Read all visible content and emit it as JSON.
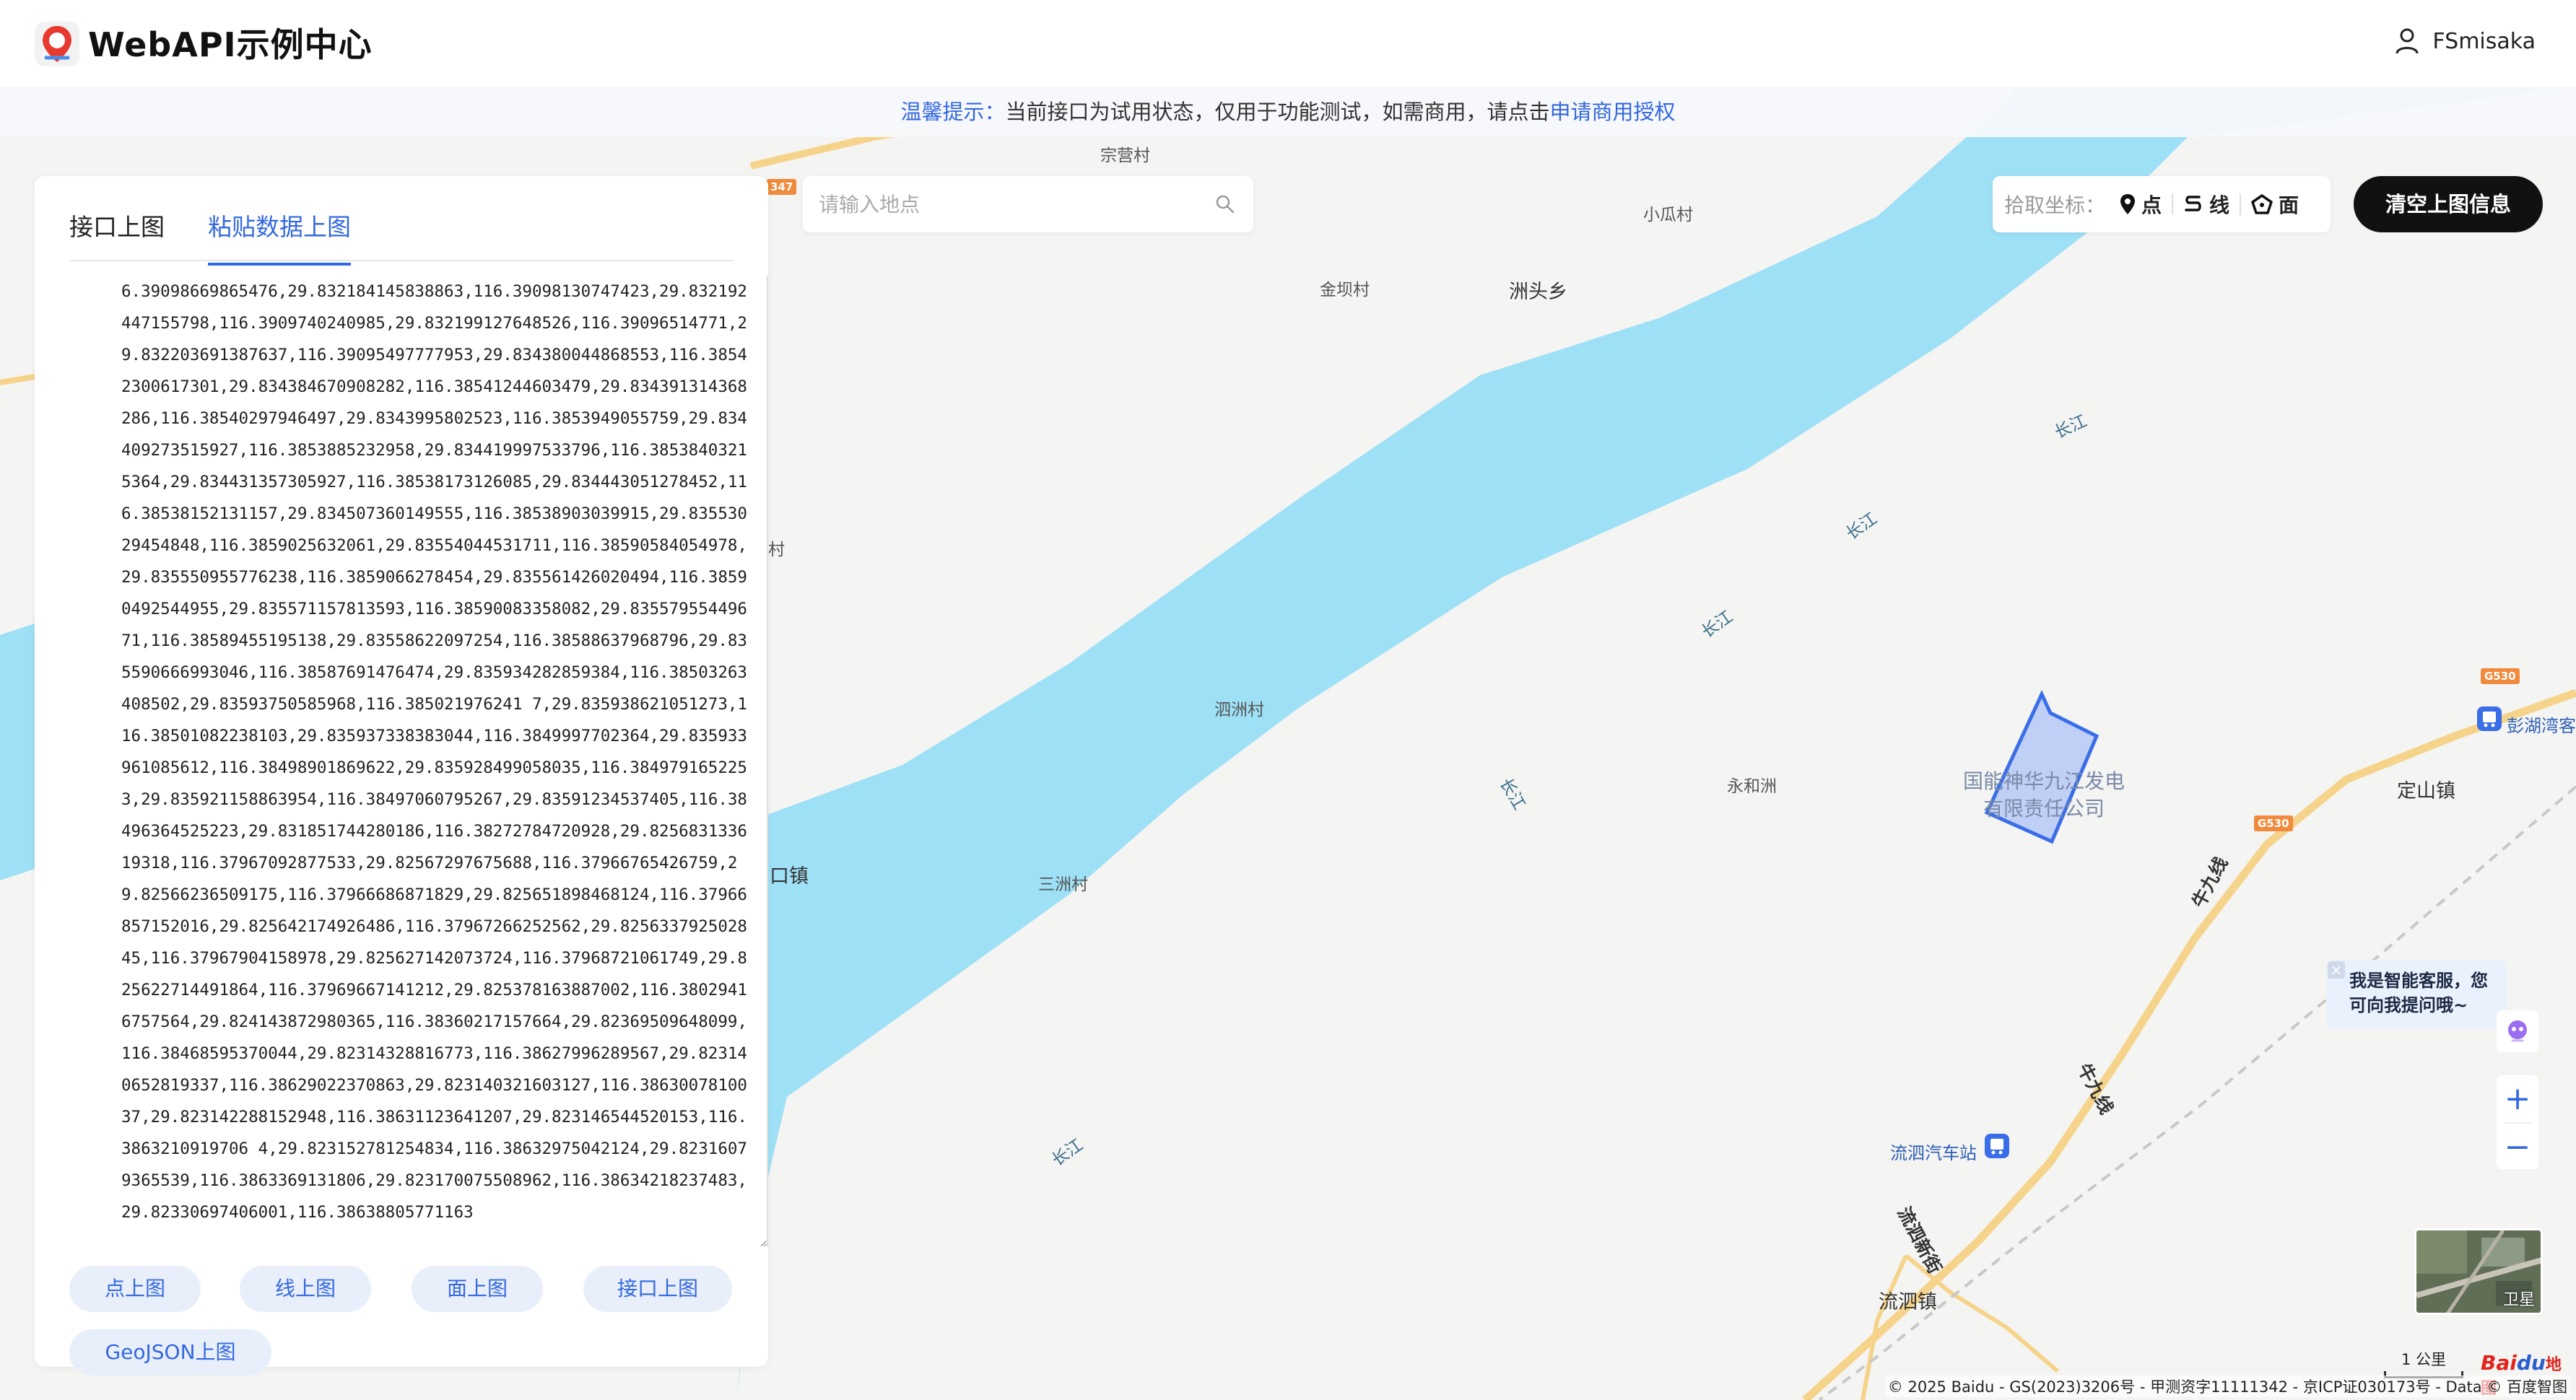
{
  "header": {
    "brand": "WebAPI示例中心",
    "username": "FSmisaka"
  },
  "notice": {
    "prefix": "温馨提示：",
    "text": "当前接口为试用状态，仅用于功能测试，如需商用，请点击",
    "link": "申请商用授权"
  },
  "panel": {
    "tabs": [
      {
        "label": "接口上图",
        "active": false
      },
      {
        "label": "粘贴数据上图",
        "active": true
      }
    ],
    "textarea_value": "6.39098669865476,29.832184145838863,116.39098130747423,29.832192447155798,116.3909740240985,29.832199127648526,116.39096514771,29.832203691387637,116.39095497777953,29.834380044868553,116.38542300617301,29.834384670908282,116.38541244603479,29.834391314368286,116.38540297946497,29.8343995802523,116.3853949055759,29.834409273515927,116.3853885232958,29.834419997533796,116.38538403215364,29.834431357305927,116.38538173126085,29.834443051278452,116.38538152131157,29.834507360149555,116.38538903039915,29.83553029454848,116.3859025632061,29.83554044531711,116.38590584054978,29.835550955776238,116.3859066278454,29.835561426020494,116.38590492544955,29.835571157813593,116.38590083358082,29.83557955449671,116.38589455195138,29.83558622097254,116.38588637968796,29.835590666993046,116.38587691476474,29.835934282859384,116.38503263408502,29.83593750585968,116.385021976241 7,29.835938621051273,116.38501082238103,29.835937338383044,116.3849997702364,29.835933961085612,116.38498901869622,29.835928499058035,116.3849791652253,29.835921158863954,116.38497060795267,29.83591234537405,116.38496364525223,29.831851744280186,116.38272784720928,29.825683133619318,116.37967092877533,29.82567297675688,116.37966765426759,29.82566236509175,116.37966686871829,29.825651898468124,116.37966857152016,29.825642174926486,116.37967266252562,29.825633792502845,116.37967904158978,29.825627142073724,116.37968721061749,29.825622714491864,116.37969667141212,29.825378163887002,116.38029416757564,29.824143872980365,116.38360217157664,29.82369509648099,116.38468595370044,29.82314328816773,116.38627996289567,29.823140652819337,116.38629022370863,29.823140321603127,116.3863007810037,29.823142288152948,116.38631123641207,29.823146544520153,116.3863210919706 4,29.823152781254834,116.38632975042124,29.82316079365539,116.3863369131806,29.823170075508962,116.38634218237483,29.82330697406001,116.38638805771163",
    "buttons": [
      "点上图",
      "线上图",
      "面上图",
      "接口上图",
      "GeoJSON上图"
    ]
  },
  "search": {
    "placeholder": "请输入地点",
    "value": ""
  },
  "pick": {
    "label": "拾取坐标：",
    "options": [
      "点",
      "线",
      "面"
    ]
  },
  "clear_button": "清空上图信息",
  "assistant": {
    "line1": "我是智能客服，您",
    "line2": "可向我提问哦~",
    "close": "×"
  },
  "zoom": {
    "in": "+",
    "out": "−"
  },
  "satellite_label": "卫星",
  "scale_label": "1 公里",
  "baidu_logo": {
    "part1": "Bai",
    "part2": "du",
    "part3": "地图"
  },
  "copyright": "© 2025 Baidu - GS(2023)3206号 - 甲测资字11111342 - 京ICP证030173号 - Data © 百度智图",
  "map_labels": {
    "zongying": "宗营村",
    "xiaogua": "小瓜村",
    "jinba": "金坝村",
    "zhoutou": "洲头乡",
    "cun_left": "村",
    "sizhou": "泗洲村",
    "yonghezhou": "永和洲",
    "kou_town": "口镇",
    "sanzhou": "三洲村",
    "dingshan": "定山镇",
    "penghu": "彭湖湾客",
    "power_plant_1": "国能神华九江发电",
    "power_plant_2": "有限责任公司",
    "liusi_bus": "流泗汽车站",
    "liusi_street": "流泗新街",
    "liusi_town": "流泗镇",
    "niujiu_1": "牛九线",
    "niujiu_2": "牛九线",
    "river_1": "长江",
    "river_2": "长江",
    "river_3": "长江",
    "river_4": "长江",
    "river_5": "长江",
    "shield_g530a": "G530",
    "shield_g530b": "G530",
    "shield_347": "347"
  },
  "colors": {
    "accent": "#3468e0",
    "river": "#9ee0f6",
    "land": "#f4f4f2",
    "polygon_fill": "#b9cbf5",
    "polygon_stroke": "#3a6ee8",
    "road": "#f6d38a"
  }
}
